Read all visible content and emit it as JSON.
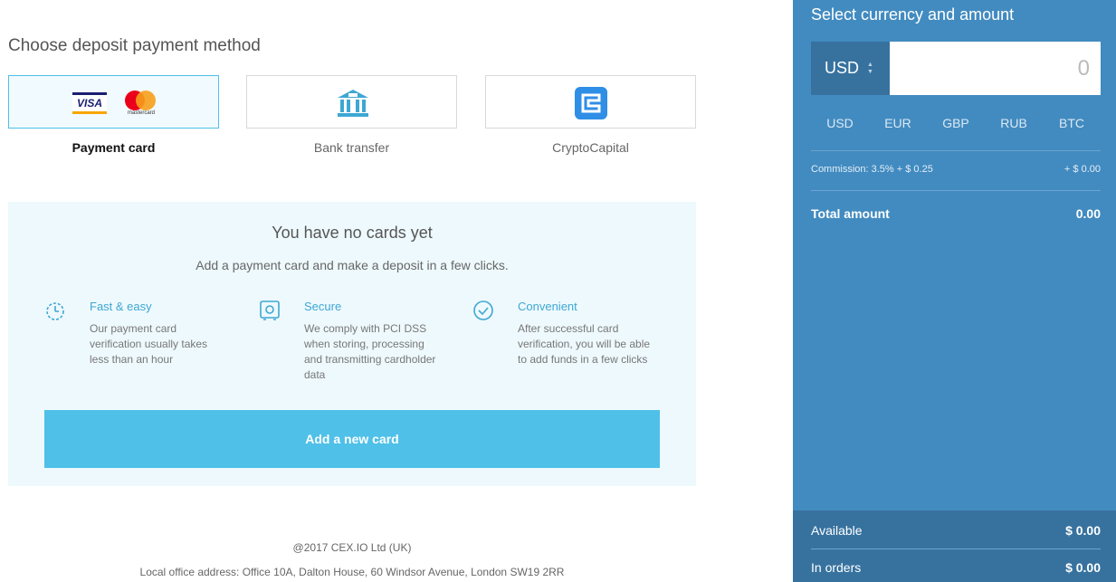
{
  "page_title": "Choose deposit payment method",
  "methods": [
    {
      "label": "Payment card",
      "active": true
    },
    {
      "label": "Bank transfer",
      "active": false
    },
    {
      "label": "CryptoCapital",
      "active": false
    }
  ],
  "card_logos": {
    "visa": "VISA",
    "mastercard": "mastercard"
  },
  "panel": {
    "title": "You have no cards yet",
    "subtitle": "Add a payment card and make a deposit in a few clicks.",
    "features": [
      {
        "icon": "timer-icon",
        "title": "Fast & easy",
        "text": "Our payment card verification usually takes less than an hour"
      },
      {
        "icon": "safe-icon",
        "title": "Secure",
        "text": "We comply with PCI DSS when storing, processing and transmitting cardholder data"
      },
      {
        "icon": "check-circle-icon",
        "title": "Convenient",
        "text": "After successful card verification, you will be able to add funds in a few clicks"
      }
    ],
    "add_button": "Add a new card"
  },
  "footer": {
    "copyright": "@2017 CEX.IO Ltd (UK)",
    "address": "Local office address: Office 10A, Dalton House, 60 Windsor Avenue, London SW19 2RR"
  },
  "sidebar": {
    "title": "Select currency and amount",
    "selected_currency": "USD",
    "amount_placeholder": "0",
    "currencies": [
      "USD",
      "EUR",
      "GBP",
      "RUB",
      "BTC"
    ],
    "commission_label": "Commission: 3.5% + $ 0.25",
    "commission_value": "+ $ 0.00",
    "total_label": "Total amount",
    "total_value": "0.00",
    "available_label": "Available",
    "available_value": "$ 0.00",
    "in_orders_label": "In orders",
    "in_orders_value": "$ 0.00"
  },
  "colors": {
    "accent": "#4fc0e8",
    "sidebar": "#428bc0",
    "sidebar_dark": "#37729f",
    "panel_bg": "#eef9fd"
  }
}
